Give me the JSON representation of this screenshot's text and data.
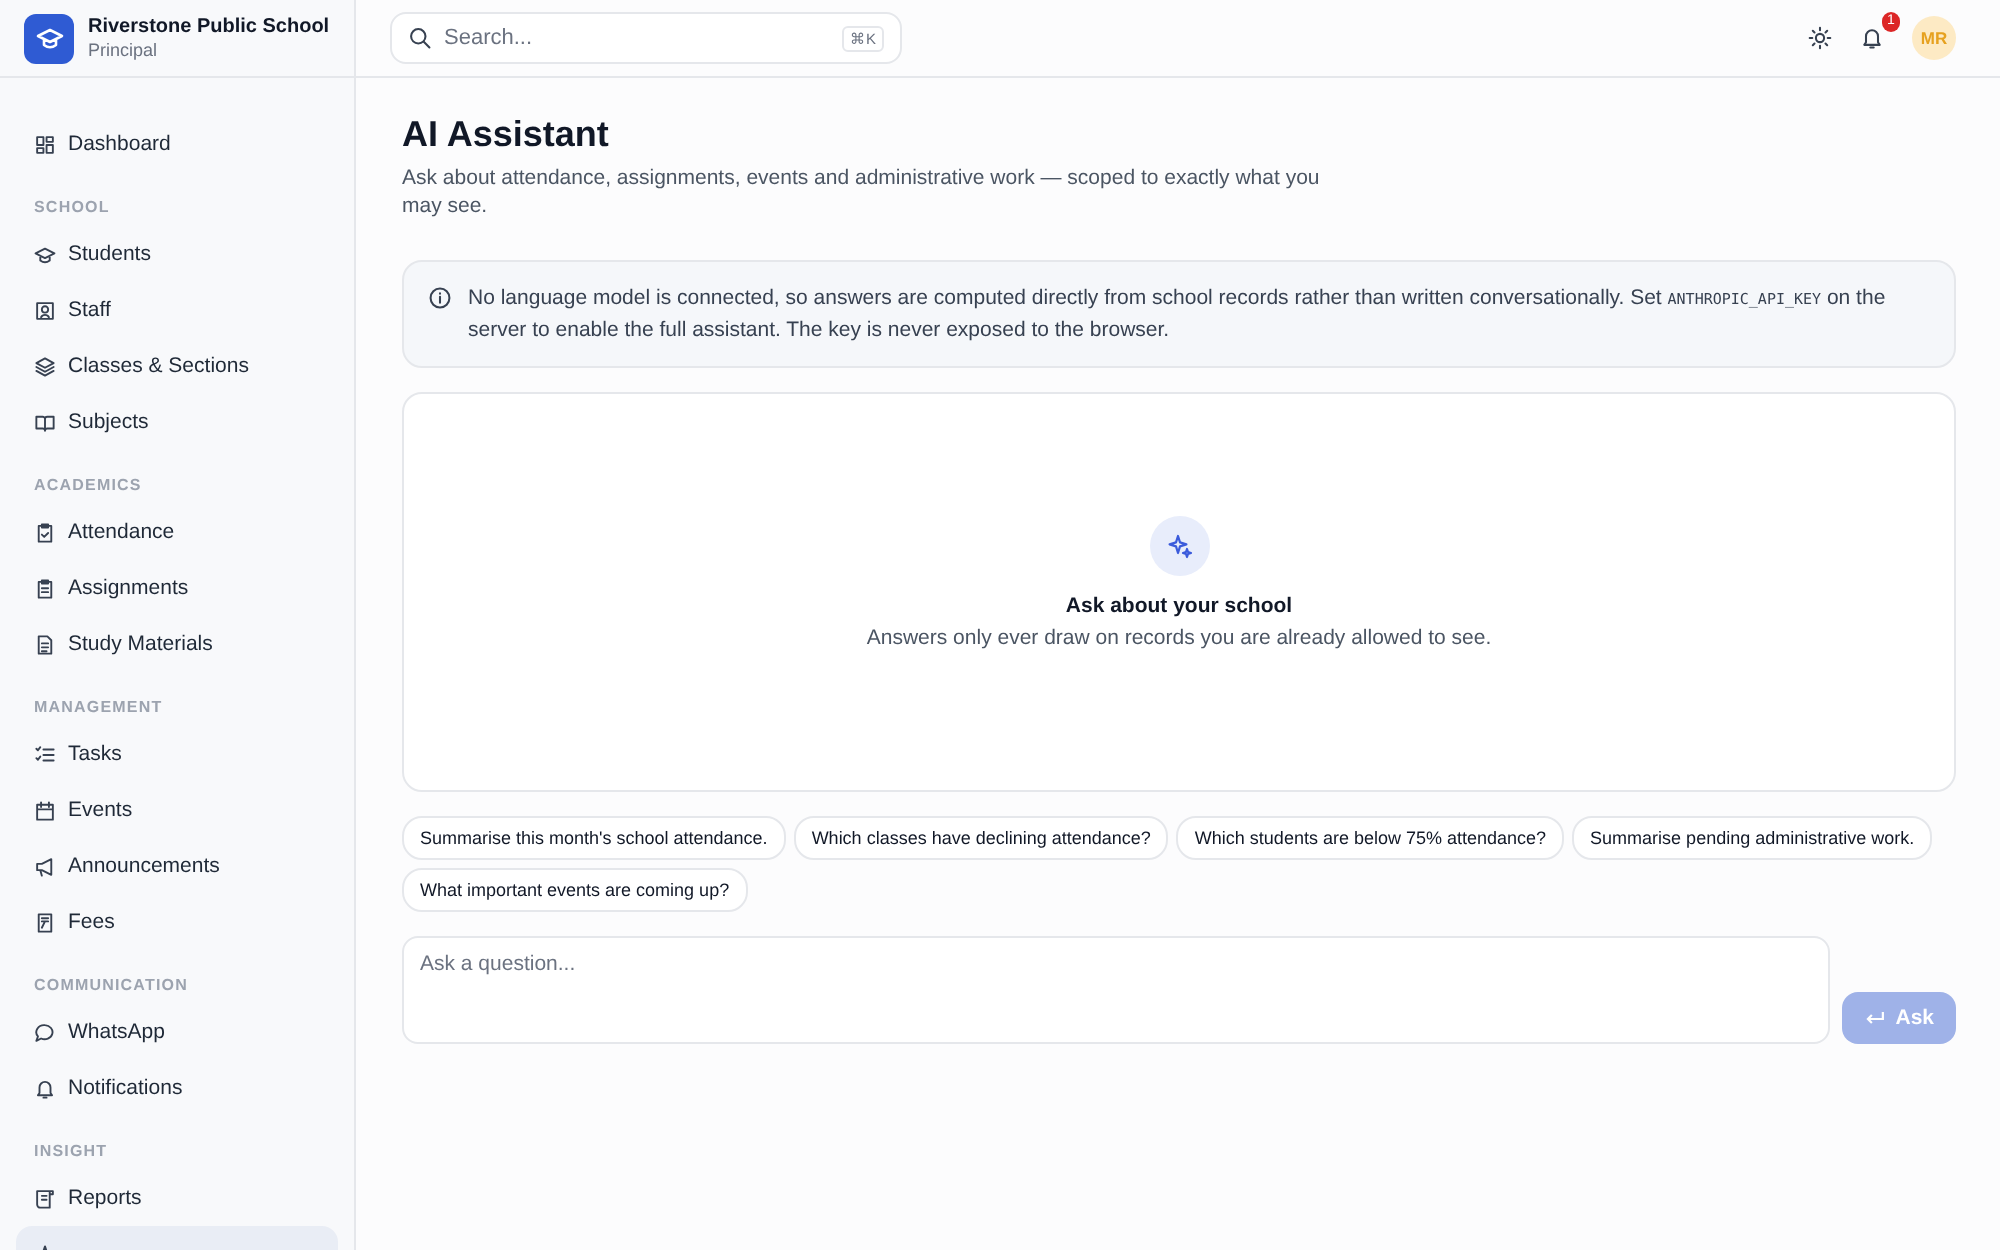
{
  "sidebar": {
    "school_name": "Riverstone Public School",
    "role": "Principal",
    "top_items": [
      {
        "label": "Dashboard",
        "selected": false
      }
    ],
    "sections": [
      {
        "title": "SCHOOL",
        "items": [
          {
            "label": "Students",
            "selected": false
          },
          {
            "label": "Staff",
            "selected": false
          },
          {
            "label": "Classes & Sections",
            "selected": false
          },
          {
            "label": "Subjects",
            "selected": false
          }
        ]
      },
      {
        "title": "ACADEMICS",
        "items": [
          {
            "label": "Attendance",
            "selected": false
          },
          {
            "label": "Assignments",
            "selected": false
          },
          {
            "label": "Study Materials",
            "selected": false
          }
        ]
      },
      {
        "title": "MANAGEMENT",
        "items": [
          {
            "label": "Tasks",
            "selected": false
          },
          {
            "label": "Events",
            "selected": false
          },
          {
            "label": "Announcements",
            "selected": false
          },
          {
            "label": "Fees",
            "selected": false
          }
        ]
      },
      {
        "title": "COMMUNICATION",
        "items": [
          {
            "label": "WhatsApp",
            "selected": false
          },
          {
            "label": "Notifications",
            "selected": false
          }
        ]
      },
      {
        "title": "INSIGHT",
        "items": [
          {
            "label": "Reports",
            "selected": false
          },
          {
            "selected": true
          }
        ]
      }
    ]
  },
  "topbar": {
    "search": {
      "placeholder": "Search...",
      "shortcut": "⌘K"
    },
    "notification_count": "1",
    "avatar": "MR"
  },
  "page": {
    "title": "AI Assistant",
    "subtitle": "Ask about attendance, assignments, events and administrative work — scoped to exactly what you may see.",
    "notice": [
      {
        "kind": "text",
        "text": "No language model is connected, so answers are computed directly from school records rather than written conversationally. Set "
      },
      {
        "kind": "code",
        "text": "ANTHROPIC_API_KEY"
      },
      {
        "kind": "text",
        "text": " on the server to enable the full assistant. The key is never exposed to the browser."
      }
    ],
    "empty_state": {
      "title": "Ask about your school",
      "text": "Answers only ever draw on records you are already allowed to see."
    },
    "suggestions": [
      "Summarise this month's school attendance.",
      "Which classes have declining attendance?",
      "Which students are below 75% attendance?",
      "Summarise pending administrative work.",
      "What important events are coming up?"
    ],
    "question": {
      "placeholder": "Ask a question..."
    },
    "ask_button": {
      "label": "Ask",
      "disabled": true
    }
  }
}
